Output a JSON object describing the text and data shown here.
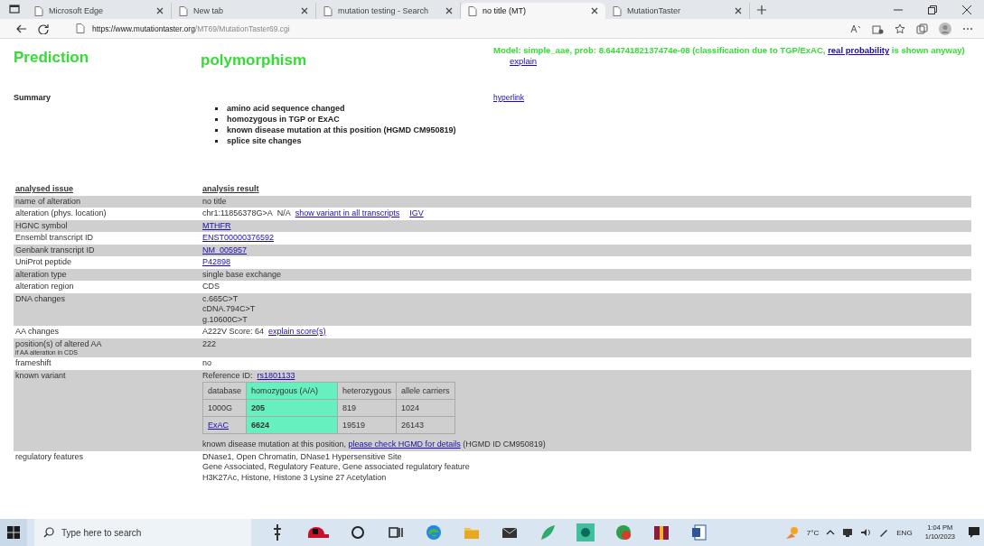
{
  "browser": {
    "tabs": [
      {
        "title": "Microsoft Edge",
        "selected": false
      },
      {
        "title": "New tab",
        "selected": false
      },
      {
        "title": "mutation testing - Search",
        "selected": false
      },
      {
        "title": "no title (MT)",
        "selected": true
      },
      {
        "title": "MutationTaster",
        "selected": false
      }
    ],
    "address": {
      "host": "https://www.mutationtaster.org",
      "path": "/MT69/MutationTaster69.cgi"
    }
  },
  "page": {
    "prediction_label": "Prediction",
    "prediction": "polymorphism",
    "model": {
      "before": "Model: simple_aae, prob: 8.64474182137474e-08 (classification due to TGP/ExAC, ",
      "link": "real probability",
      "after": " is shown anyway)",
      "explain": "explain"
    },
    "summary": {
      "label": "Summary",
      "items": [
        "amino acid sequence changed",
        "homozygous in TGP or ExAC",
        "known disease mutation at this position (HGMD CM950819)",
        "splice site changes"
      ],
      "hyperlink": "hyperlink"
    },
    "table": {
      "columns": [
        "analysed issue",
        "analysis result"
      ],
      "rows": [
        {
          "label": "name of alteration",
          "shaded": true,
          "kind": "lines",
          "lines": [
            [
              {
                "kind": "text",
                "text": "no title"
              }
            ]
          ]
        },
        {
          "label": "alteration (phys. location)",
          "shaded": false,
          "kind": "lines",
          "lines": [
            [
              {
                "kind": "text",
                "text": "chr1:11856378G>A"
              },
              {
                "kind": "text",
                "text": "N/A"
              },
              {
                "kind": "link",
                "text": "show variant in all transcripts"
              },
              {
                "kind": "link",
                "text": "IGV"
              }
            ]
          ]
        },
        {
          "label": "HGNC symbol",
          "shaded": true,
          "kind": "lines",
          "lines": [
            [
              {
                "kind": "link",
                "text": "MTHFR"
              }
            ]
          ]
        },
        {
          "label": "Ensembl transcript ID",
          "shaded": false,
          "kind": "lines",
          "lines": [
            [
              {
                "kind": "link",
                "text": "ENST00000376592"
              }
            ]
          ]
        },
        {
          "label": "Genbank transcript ID",
          "shaded": true,
          "kind": "lines",
          "lines": [
            [
              {
                "kind": "link",
                "text": "NM_005957"
              }
            ]
          ]
        },
        {
          "label": "UniProt peptide",
          "shaded": false,
          "kind": "lines",
          "lines": [
            [
              {
                "kind": "link",
                "text": "P42898"
              }
            ]
          ]
        },
        {
          "label": "alteration type",
          "shaded": true,
          "kind": "lines",
          "lines": [
            [
              {
                "kind": "text",
                "text": "single base exchange"
              }
            ]
          ]
        },
        {
          "label": "alteration region",
          "shaded": false,
          "kind": "lines",
          "lines": [
            [
              {
                "kind": "text",
                "text": "CDS"
              }
            ]
          ]
        },
        {
          "label": "DNA changes",
          "shaded": true,
          "kind": "lines",
          "lines": [
            [
              {
                "kind": "text",
                "text": "c.665C>T"
              }
            ],
            [
              {
                "kind": "text",
                "text": "cDNA.794C>T"
              }
            ],
            [
              {
                "kind": "text",
                "text": "g.10600C>T"
              }
            ]
          ]
        },
        {
          "label": "AA changes",
          "shaded": false,
          "kind": "lines",
          "lines": [
            [
              {
                "kind": "text",
                "text": "A222V Score: 64"
              },
              {
                "kind": "link",
                "text": "explain score(s)"
              }
            ]
          ]
        },
        {
          "label": "position(s) of altered AA",
          "sublabel": "if AA alteration in CDS",
          "shaded": true,
          "kind": "lines",
          "lines": [
            [
              {
                "kind": "text",
                "text": "222"
              }
            ]
          ]
        },
        {
          "label": "frameshift",
          "shaded": false,
          "kind": "lines",
          "lines": [
            [
              {
                "kind": "text",
                "text": "no"
              }
            ]
          ]
        },
        {
          "label": "known variant",
          "shaded": true,
          "kind": "variant",
          "reference_label": "Reference ID:",
          "reference_id": "rs1801133",
          "variant_table": {
            "columns": [
              {
                "title": "database",
                "highlight": false
              },
              {
                "title": "homozygous (A/A)",
                "highlight": true
              },
              {
                "title": "heterozygous",
                "highlight": false
              },
              {
                "title": "allele carriers",
                "highlight": false
              }
            ],
            "rows": [
              [
                {
                  "kind": "text",
                  "text": "1000G"
                },
                {
                  "kind": "text",
                  "text": "205"
                },
                {
                  "kind": "text",
                  "text": "819"
                },
                {
                  "kind": "text",
                  "text": "1024"
                }
              ],
              [
                {
                  "kind": "link",
                  "text": "ExAC"
                },
                {
                  "kind": "text",
                  "text": "6624"
                },
                {
                  "kind": "text",
                  "text": "19519"
                },
                {
                  "kind": "text",
                  "text": "26143"
                }
              ]
            ]
          },
          "note": {
            "before": "known disease mutation at this position, ",
            "link": "please check HGMD for details",
            "after": " (HGMD ID CM950819)"
          }
        },
        {
          "label": "regulatory features",
          "shaded": false,
          "kind": "lines",
          "lines": [
            [
              {
                "kind": "text",
                "text": "DNase1, Open Chromatin, DNase1 Hypersensitive Site"
              }
            ],
            [
              {
                "kind": "text",
                "text": "Gene Associated, Regulatory Feature, Gene associated regulatory feature"
              }
            ],
            [
              {
                "kind": "text",
                "text": "H3K27Ac, Histone, Histone 3 Lysine 27 Acetylation"
              }
            ]
          ]
        }
      ]
    }
  },
  "taskbar": {
    "search_placeholder": "Type here to search",
    "temperature": "7°C",
    "language": "ENG",
    "time": "1:04 PM",
    "date": "1/10/2023"
  }
}
